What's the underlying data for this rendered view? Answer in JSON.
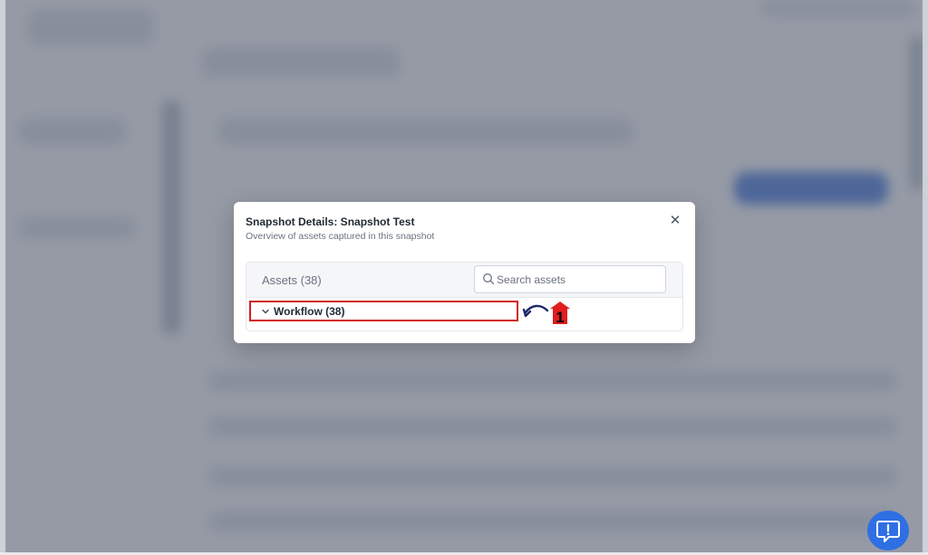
{
  "colors": {
    "accent": "#2f6fe4",
    "highlight": "#d11f1f",
    "annotation_red": "#e11d1d",
    "annotation_arrow": "#1e2a6b"
  },
  "modal": {
    "title": "Snapshot Details: Snapshot Test",
    "subtitle": "Overview of assets captured in this snapshot",
    "close_icon": "close-icon"
  },
  "assets": {
    "title": "Assets (38)",
    "search_placeholder": "Search assets",
    "search_value": "",
    "groups": [
      {
        "label": "Workflow (38)",
        "expanded": true
      }
    ]
  },
  "annotation": {
    "step_number": "1"
  },
  "feedback": {
    "icon": "feedback-icon"
  }
}
